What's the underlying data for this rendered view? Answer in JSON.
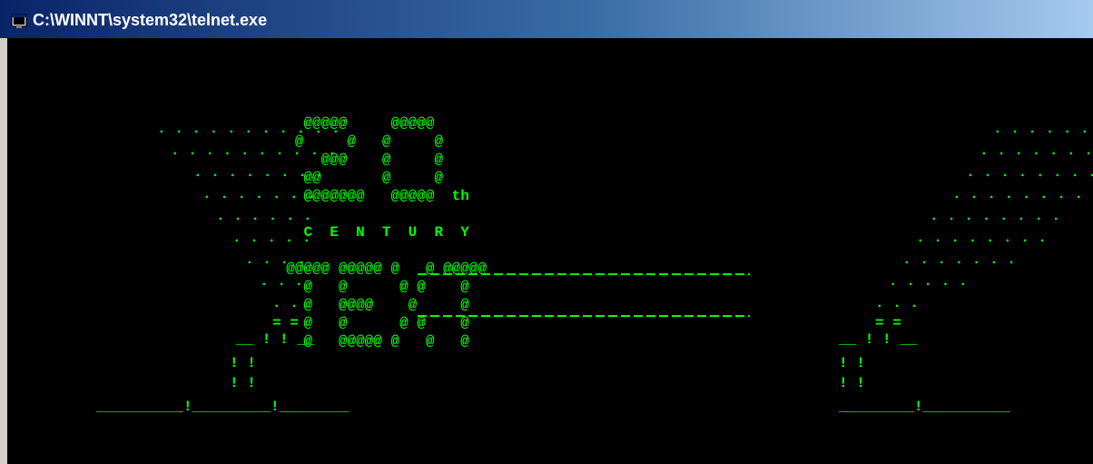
{
  "window": {
    "title": "C:\\WINNT\\system32\\telnet.exe",
    "title_icon": "console-window-icon"
  },
  "colors": {
    "console_bg": "#000000",
    "console_text": "#00ff00",
    "titlebar_start": "#0a246a",
    "titlebar_end": "#a6caf0"
  },
  "console": {
    "lines": [
      "",
      "",
      "",
      "",
      "                                  @@@@@     @@@@@",
      "                                 @     @   @     @",
      "                                    @@@    @     @",
      "                                  @@       @     @",
      "                                  @@@@@@@   @@@@@  th",
      "",
      "                                  C  E  N  T  U  R  Y",
      "",
      "                                @@@@@ @@@@@ @   @ @@@@@",
      "                                  @   @      @ @    @",
      "                                  @   @@@@    @     @",
      "                                  @   @      @ @    @",
      "                                  @   @@@@@ @   @   @"
    ]
  }
}
